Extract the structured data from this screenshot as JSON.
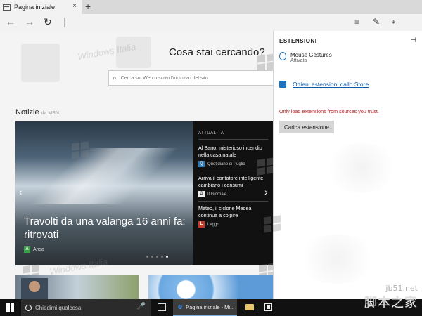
{
  "browser": {
    "tab": {
      "title": "Pagina iniziale",
      "close_glyph": "×",
      "icon": "tab-page-icon"
    },
    "new_tab_glyph": "+",
    "nav": {
      "back_glyph": "←",
      "forward_glyph": "→",
      "refresh_glyph": "↻"
    },
    "tools": {
      "hub_glyph": "≡",
      "note_glyph": "✎",
      "extensions_glyph": "⌖"
    }
  },
  "home": {
    "search_title": "Cosa stai cercando?",
    "search_placeholder": "Cerca sul Web o scrivi l'indirizzo del sito",
    "news_heading": "Notizie",
    "news_source": "da MSN",
    "hero": {
      "title": "Travolti da una valanga 16 anni fa: ritrovati",
      "source": "Ansa",
      "source_color": "#3aa14a"
    },
    "side_heading": "ATTUALITÀ",
    "side_items": [
      {
        "title": "Al Bano, misterioso incendio nella casa natale",
        "source": "Quotidiano di Puglia",
        "logo": "Q",
        "color": "#2a7ab8"
      },
      {
        "title": "Arriva il contatore intelligente, cambiano i consumi",
        "source": "Il Giornale",
        "logo": "G",
        "color": "#555555"
      },
      {
        "title": "Meteo, il ciclone Medea continua a colpire",
        "source": "Leggo",
        "logo": "L",
        "color": "#c23a2a"
      }
    ]
  },
  "extensions": {
    "title": "ESTENSIONI",
    "pin_glyph": "⊣",
    "items": [
      {
        "name": "Mouse Gestures",
        "state": "Attivata"
      }
    ],
    "store_link": "Ottieni estensioni dallo Store",
    "warning": "Only load extensions from sources you trust.",
    "load_button": "Carica estensione"
  },
  "taskbar": {
    "search_placeholder": "Chiedimi qualcosa",
    "mic_glyph": "🎤",
    "edge_task_label": "Pagina iniziale - Mi...",
    "edge_glyph": "e"
  },
  "watermark": {
    "text": "Windows Italia",
    "site": "jb51.net",
    "site_cn": "脚本之家"
  }
}
